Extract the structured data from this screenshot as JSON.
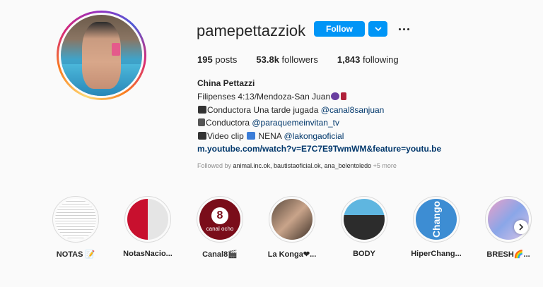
{
  "profile": {
    "username": "pamepettazziok",
    "follow_label": "Follow",
    "posts_count": "195",
    "posts_label": " posts",
    "followers_count": "53.8k",
    "followers_label": " followers",
    "following_count": "1,843",
    "following_label": " following",
    "full_name": "China Pettazzi"
  },
  "bio": {
    "line1_text": "Filipenses 4:13/Mendoza-San Juan",
    "line2_text": "Conductora Una tarde jugada ",
    "line2_mention": "@canal8sanjuan",
    "line3_text": "Conductora ",
    "line3_mention": "@paraquemeinvitan_tv",
    "line4_text": "Video clip ",
    "line4_text2": " NENA ",
    "line4_mention": "@lakongaoficial",
    "link": "m.youtube.com/watch?v=E7C7E9TwmWM&feature=youtu.be"
  },
  "followed_by": {
    "prefix": "Followed by ",
    "names": "animal.inc.ok, bautistaoficial.ok, ana_belentoledo",
    "more": " +5 more"
  },
  "highlights": [
    {
      "label": "NOTAS 📝"
    },
    {
      "label": "NotasNacio..."
    },
    {
      "label": "Canal8🎬"
    },
    {
      "label": "La Konga❤..."
    },
    {
      "label": "BODY"
    },
    {
      "label": "HiperChang..."
    },
    {
      "label": "BRESH🌈..."
    }
  ],
  "highlight_art": {
    "canal8_number": "8",
    "canal8_text": "canal ocho",
    "hiper_text": "Chango"
  },
  "colors": {
    "accent": "#0095f6",
    "link": "#00376b",
    "muted": "#8e8e8e"
  }
}
